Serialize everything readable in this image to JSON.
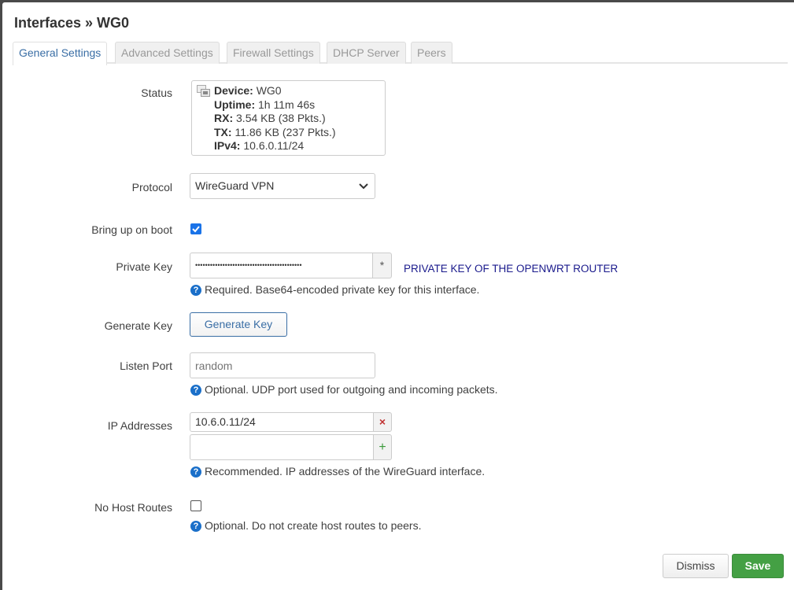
{
  "title": "Interfaces » WG0",
  "tabs": [
    {
      "label": "General Settings",
      "active": true
    },
    {
      "label": "Advanced Settings",
      "active": false
    },
    {
      "label": "Firewall Settings",
      "active": false
    },
    {
      "label": "DHCP Server",
      "active": false
    },
    {
      "label": "Peers",
      "active": false
    }
  ],
  "status": {
    "label": "Status",
    "device_key": "Device:",
    "device_val": " WG0",
    "uptime_key": "Uptime:",
    "uptime_val": " 1h 11m 46s",
    "rx_key": "RX:",
    "rx_val": " 3.54 KB (38 Pkts.)",
    "tx_key": "TX:",
    "tx_val": " 11.86 KB (237 Pkts.)",
    "ipv4_key": "IPv4:",
    "ipv4_val": " 10.6.0.11/24"
  },
  "protocol": {
    "label": "Protocol",
    "value": "WireGuard VPN"
  },
  "bring_up": {
    "label": "Bring up on boot",
    "checked": true
  },
  "private_key": {
    "label": "Private Key",
    "value": "•••••••••••••••••••••••••••••••••••••••••••",
    "reveal": "*",
    "annotation": "PRIVATE KEY OF THE OPENWRT ROUTER",
    "hint": "Required. Base64-encoded private key for this interface."
  },
  "generate_key": {
    "label": "Generate Key",
    "button": "Generate Key"
  },
  "listen_port": {
    "label": "Listen Port",
    "placeholder": "random",
    "value": "",
    "hint": "Optional. UDP port used for outgoing and incoming packets."
  },
  "ip_addresses": {
    "label": "IP Addresses",
    "values": [
      "10.6.0.11/24",
      ""
    ],
    "remove": "×",
    "add": "+",
    "hint": "Recommended. IP addresses of the WireGuard interface."
  },
  "no_host_routes": {
    "label": "No Host Routes",
    "checked": false,
    "hint": "Optional. Do not create host routes to peers."
  },
  "help_glyph": "?",
  "footer": {
    "dismiss": "Dismiss",
    "save": "Save"
  }
}
